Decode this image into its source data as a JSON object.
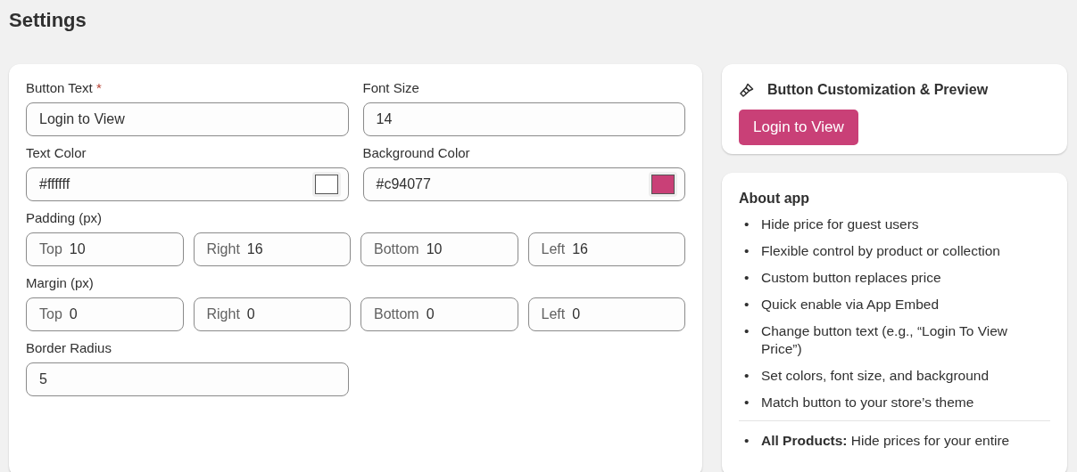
{
  "page_title": "Settings",
  "form": {
    "button_text": {
      "label": "Button Text",
      "required_mark": "*",
      "value": "Login to View"
    },
    "font_size": {
      "label": "Font Size",
      "value": "14"
    },
    "text_color": {
      "label": "Text Color",
      "value": "#ffffff",
      "color": "#ffffff"
    },
    "background_color": {
      "label": "Background Color",
      "value": "#c94077",
      "color": "#c94077"
    },
    "padding": {
      "label": "Padding (px)",
      "fields": [
        {
          "label": "Top",
          "value": "10"
        },
        {
          "label": "Right",
          "value": "16"
        },
        {
          "label": "Bottom",
          "value": "10"
        },
        {
          "label": "Left",
          "value": "16"
        }
      ]
    },
    "margin": {
      "label": "Margin (px)",
      "fields": [
        {
          "label": "Top",
          "value": "0"
        },
        {
          "label": "Right",
          "value": "0"
        },
        {
          "label": "Bottom",
          "value": "0"
        },
        {
          "label": "Left",
          "value": "0"
        }
      ]
    },
    "border_radius": {
      "label": "Border Radius",
      "value": "5"
    }
  },
  "preview": {
    "title": "Button Customization & Preview",
    "button": "Login to View"
  },
  "about": {
    "title": "About app",
    "features": [
      {
        "bullet": "•",
        "text": "Hide price for guest users"
      },
      {
        "bullet": "•",
        "text": "Flexible control by product or collection"
      },
      {
        "bullet": "•",
        "text": "Custom button replaces price"
      },
      {
        "bullet": "•",
        "text": "Quick enable via App Embed"
      },
      {
        "bullet": "•",
        "text": "Change button text (e.g., “Login To View Price”)"
      },
      {
        "bullet": "•",
        "text": "Set colors, font size, and background"
      },
      {
        "bullet": "•",
        "text": "Match button to your store’s theme"
      }
    ],
    "details": [
      {
        "bullet": "•",
        "text": "**All Products:** Hide prices for your entire"
      }
    ]
  }
}
